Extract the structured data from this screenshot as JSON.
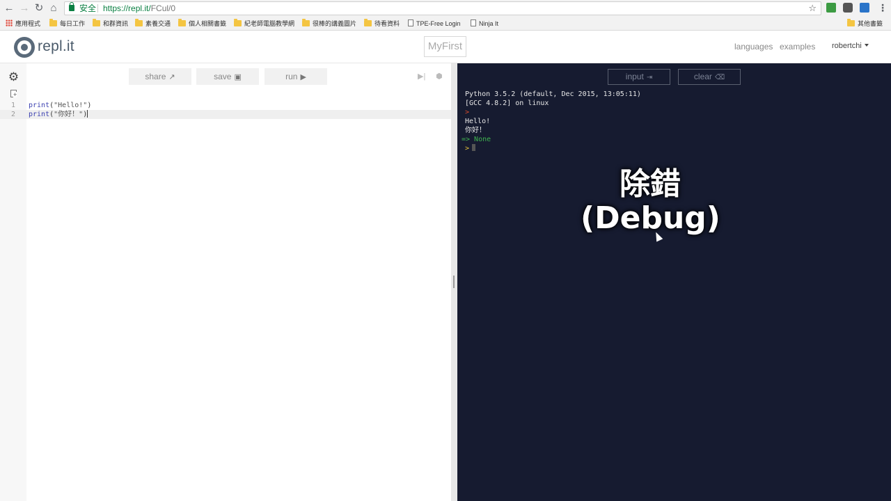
{
  "browser": {
    "secure_label": "安全",
    "url_host": "https://repl.it/",
    "url_path": "FCul/0",
    "bookmarks": [
      "應用程式",
      "每日工作",
      "和群資訊",
      "素養交通",
      "個人相關書籤",
      "紀老師電腦教學網",
      "很棒的講義圖片",
      "待看資料",
      "TPE-Free Login",
      "Ninja It",
      "其他書籤"
    ]
  },
  "header": {
    "logo_text": "repl.it",
    "project_name": "MyFirst",
    "links": [
      "languages",
      "examples"
    ],
    "user": "robertchi"
  },
  "editor": {
    "toolbar": {
      "share": "share",
      "save": "save",
      "run": "run"
    },
    "lines": [
      {
        "num": "1",
        "fn": "print",
        "open": "(",
        "str": "\"Hello!\"",
        "close": ")"
      },
      {
        "num": "2",
        "fn": "print",
        "open": "(",
        "str": "\"你好！\"",
        "close": ")"
      }
    ]
  },
  "console": {
    "buttons": {
      "input": "input",
      "clear": "clear"
    },
    "output": {
      "banner1": "Python 3.5.2 (default, Dec 2015, 13:05:11)",
      "banner2": "[GCC 4.8.2] on linux",
      "prompt": ">",
      "line_hello": "Hello!",
      "line_nihao": "你好！",
      "result": "=> None"
    }
  },
  "overlay": {
    "title": "除錯",
    "subtitle": "(Debug)"
  },
  "colors": {
    "console_bg": "#161b30",
    "accent_green": "#0b8043"
  }
}
